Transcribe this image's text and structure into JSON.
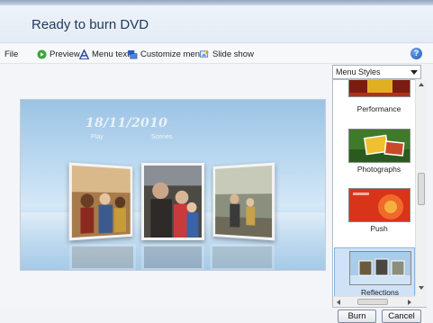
{
  "header": {
    "title": "Ready to burn DVD"
  },
  "toolbar": {
    "file": "File",
    "preview": "Preview",
    "menu_text": "Menu text",
    "customize_menu": "Customize menu",
    "slide_show": "Slide show",
    "icons": [
      "play-icon",
      "text-a-icon",
      "customize-icon",
      "slideshow-icon",
      "help-icon"
    ]
  },
  "preview": {
    "date": "18/11/2010",
    "play": "Play",
    "scenes": "Scenes"
  },
  "menu_styles": {
    "dropdown_value": "Menu Styles",
    "items": [
      {
        "label": "Performance"
      },
      {
        "label": "Photographs"
      },
      {
        "label": "Push"
      },
      {
        "label": "Reflections",
        "selected": true
      }
    ]
  },
  "footer": {
    "burn": "Burn",
    "cancel": "Cancel"
  },
  "colors": {
    "title": "#1e395b",
    "selected_item": "#cfe2f7",
    "preview_bg": "#bad8f0"
  }
}
